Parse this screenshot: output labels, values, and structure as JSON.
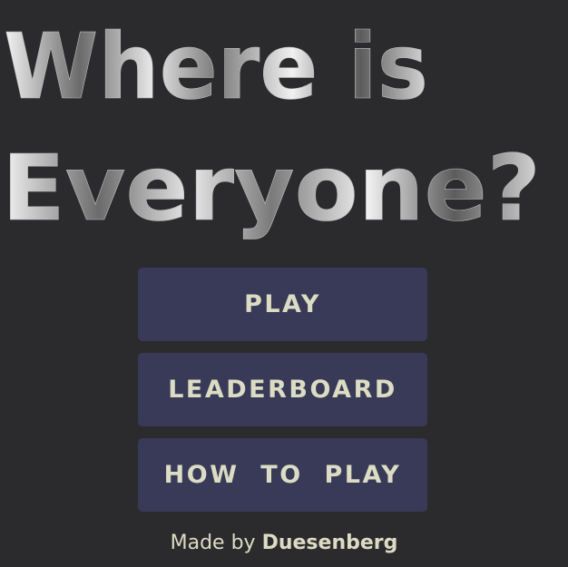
{
  "title": {
    "line1": "Where is",
    "line2": "Everyone?"
  },
  "menu": {
    "play_label": "PLAY",
    "leaderboard_label": "LEADERBOARD",
    "how_to_play_label": "HOW  TO  PLAY"
  },
  "footer": {
    "prefix": "Made by",
    "author": "Duesenberg"
  },
  "colors": {
    "background": "#2b2b2d",
    "button_bg": "#383a57",
    "button_text": "#dcdcc4"
  }
}
